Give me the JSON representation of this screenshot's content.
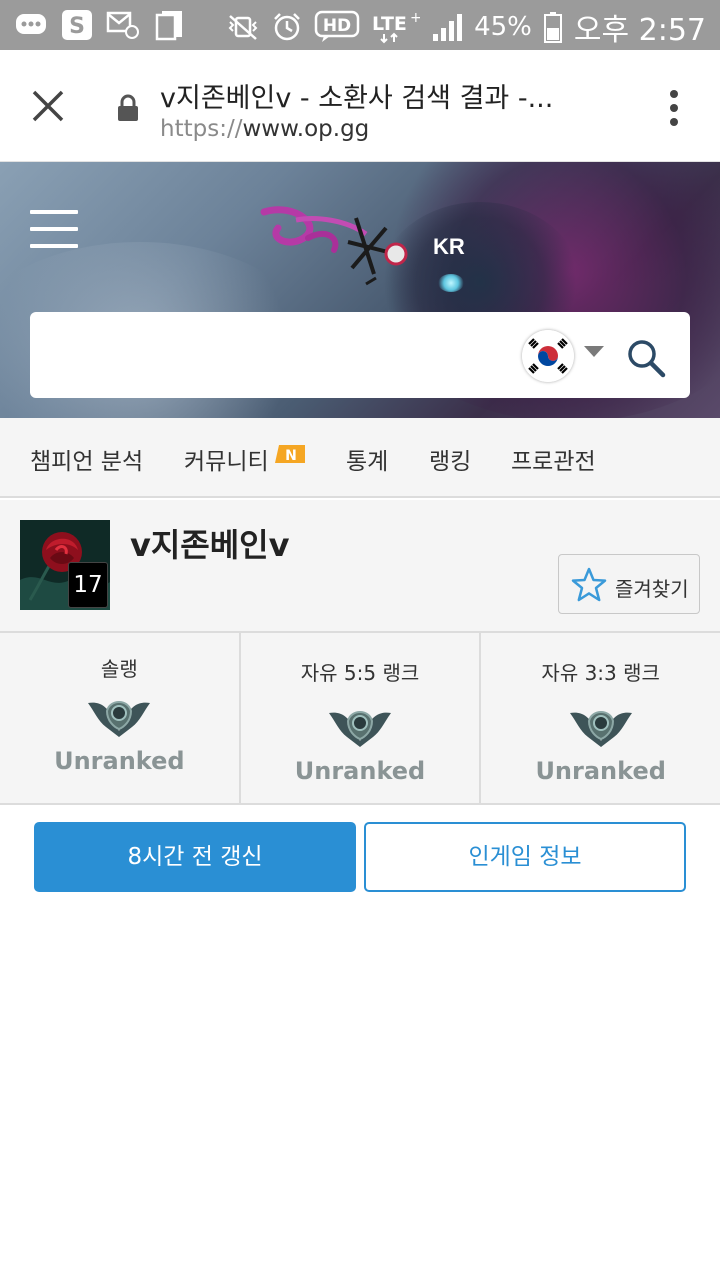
{
  "status_bar": {
    "battery": "45%",
    "network": "LTE",
    "hd_badge": "HD",
    "time": "오후 2:57",
    "icons": [
      "messages-icon",
      "skype-icon",
      "mail-icon",
      "copy-icon",
      "vibrate-mute-icon",
      "alarm-icon",
      "hd-voice-icon",
      "lte-icon",
      "signal-icon",
      "battery-icon"
    ]
  },
  "browser": {
    "title": "v지존베인v - 소환사 검색 결과 -...",
    "url_scheme": "https://",
    "url_host": "www.op.gg"
  },
  "header": {
    "region": "KR",
    "search": {
      "placeholder": "",
      "value": ""
    }
  },
  "nav": {
    "items": [
      {
        "label": "챔피언 분석"
      },
      {
        "label": "커뮤니티",
        "badge": "N"
      },
      {
        "label": "통계"
      },
      {
        "label": "랭킹"
      },
      {
        "label": "프로관전"
      }
    ]
  },
  "profile": {
    "summoner_name": "v지존베인v",
    "level": "17",
    "favorite_label": "즐겨찾기"
  },
  "ranks": [
    {
      "title": "솔랭",
      "tier": "Unranked"
    },
    {
      "title": "자유 5:5 랭크",
      "tier": "Unranked"
    },
    {
      "title": "자유 3:3 랭크",
      "tier": "Unranked"
    }
  ],
  "actions": {
    "renew_label": "8시간 전 갱신",
    "ingame_label": "인게임 정보"
  },
  "colors": {
    "accent": "#2a8fd4",
    "status_bar": "#9b9b9b",
    "unranked_text": "#8a9495",
    "nav_badge": "#f5a623"
  }
}
